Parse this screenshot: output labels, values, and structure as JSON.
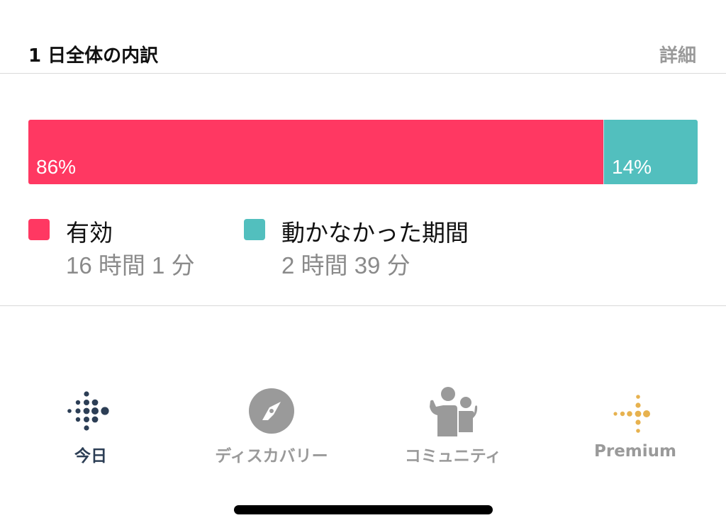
{
  "section": {
    "title": "1 日全体の内訳",
    "details_label": "詳細"
  },
  "breakdown": {
    "segments": [
      {
        "key": "active",
        "percent": 86,
        "percent_label": "86%",
        "color": "#ff3862"
      },
      {
        "key": "inactive",
        "percent": 14,
        "percent_label": "14%",
        "color": "#52bfbe"
      }
    ]
  },
  "legend": {
    "active": {
      "label": "有効",
      "value": "16 時間 1 分",
      "color": "#ff3862"
    },
    "inactive": {
      "label": "動かなかった期間",
      "value": "2 時間 39 分",
      "color": "#52bfbe"
    }
  },
  "tabs": [
    {
      "label": "今日",
      "icon": "fitbit-dots-icon",
      "color": "#2c3e55",
      "active": true
    },
    {
      "label": "ディスカバリー",
      "icon": "compass-icon",
      "color": "#9a9a9a",
      "active": false
    },
    {
      "label": "コミュニティ",
      "icon": "community-people-icon",
      "color": "#9a9a9a",
      "active": false
    },
    {
      "label": "Premium",
      "icon": "premium-arrow-dots-icon",
      "color": "#e7b24f",
      "active": false
    }
  ]
}
